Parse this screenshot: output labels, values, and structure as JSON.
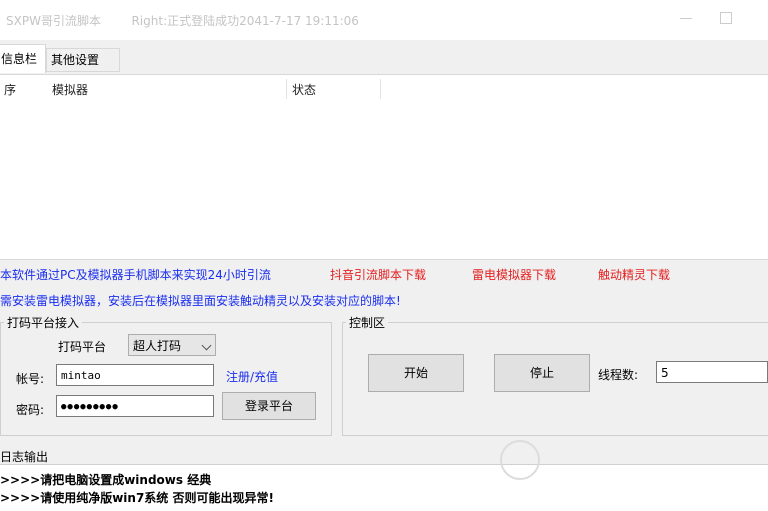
{
  "window": {
    "title": "SXPW哥引流脚本",
    "status_title": "Right:正式登陆成功2041-7-17 19:11:06"
  },
  "tabs": [
    {
      "label": "信息栏",
      "active": true
    },
    {
      "label": "其他设置",
      "active": false
    }
  ],
  "grid": {
    "columns": [
      "序",
      "模拟器",
      "状态"
    ],
    "rows": []
  },
  "notices": {
    "line1": "本软件通过PC及模拟器手机脚本来实现24小时引流",
    "link_script": "抖音引流脚本下载",
    "link_ldplayer": "雷电模拟器下载",
    "link_helper": "触动精灵下载",
    "line2": "需安装雷电模拟器，安装后在模拟器里面安装触动精灵以及安装对应的脚本!"
  },
  "captcha_group": {
    "title": "打码平台接入",
    "platform_label": "打码平台",
    "platform_value": "超人打码",
    "account_label": "帐号:",
    "account_value": "mintao",
    "password_label": "密码:",
    "password_value": "●●●●●●●●●",
    "register_link": "注册/充值",
    "login_button": "登录平台"
  },
  "control_group": {
    "title": "控制区",
    "start_button": "开始",
    "stop_button": "停止",
    "threads_label": "线程数:",
    "threads_value": "5"
  },
  "log": {
    "title": "日志输出",
    "lines": [
      ">>>>请把电脑设置成windows 经典",
      ">>>>请使用纯净版win7系统 否则可能出现异常!"
    ]
  },
  "colors": {
    "link_blue": "#1a2ef0",
    "link_red": "#e52020"
  }
}
